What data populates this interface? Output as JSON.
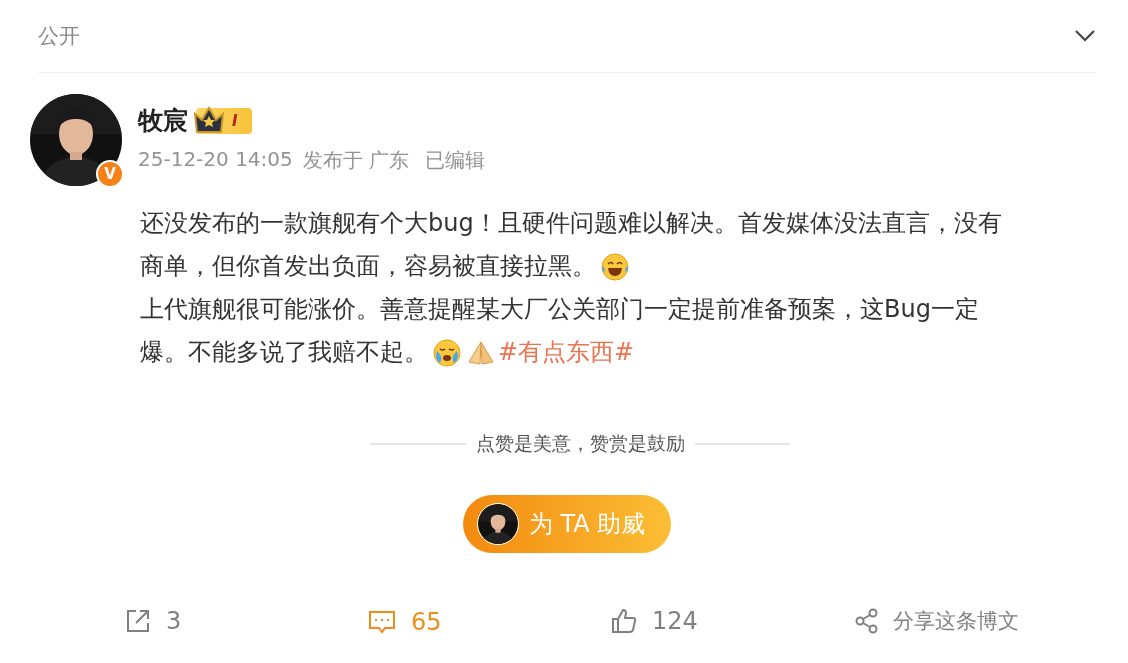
{
  "header": {
    "visibility": "公开"
  },
  "author": {
    "name": "牧宸",
    "verified_mark": "V",
    "level_badge": "I",
    "meta": [
      "25-12-20 14:05",
      "发布于 广东",
      "已编辑"
    ]
  },
  "post": [
    [
      {
        "kind": "text",
        "text": "还没发布的一款旗舰有个大bug！且硬件问题难以解决。首发媒体没法直言，没有"
      }
    ],
    [
      {
        "kind": "text",
        "text": "商单，但你首发出负面，容易被直接拉黑。"
      },
      {
        "kind": "laugh"
      }
    ],
    [
      {
        "kind": "text",
        "text": "上代旗舰很可能涨价。善意提醒某大厂公关部门一定提前准备预案，这Bug一定"
      }
    ],
    [
      {
        "kind": "text",
        "text": "爆。不能多说了我赔不起。"
      },
      {
        "kind": "cry"
      },
      {
        "kind": "pray"
      },
      {
        "kind": "hashtag",
        "text": "#有点东西#"
      }
    ]
  ],
  "reward": {
    "slogan": "点赞是美意，赞赏是鼓励",
    "button": "为 TA 助威"
  },
  "actions": [
    {
      "kind": "repost",
      "count": "3",
      "selected": false
    },
    {
      "kind": "comment",
      "count": "65",
      "selected": true
    },
    {
      "kind": "like",
      "count": "124",
      "selected": false
    },
    {
      "kind": "share",
      "count": "分享这条博文",
      "selected": false
    }
  ]
}
